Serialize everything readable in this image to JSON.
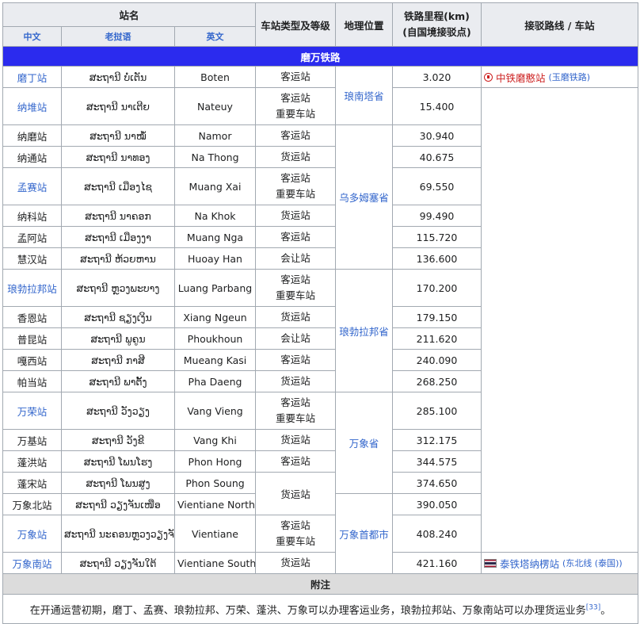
{
  "header": {
    "station_name": "站名",
    "zh": "中文",
    "lao": "老挝语",
    "en": "英文",
    "type": "车站类型及等级",
    "location": "地理位置",
    "mileage_line1": "铁路里程(km)",
    "mileage_line2": "(自国境接驳点)",
    "connection": "接驳路线 / 车站"
  },
  "banner": "磨万铁路",
  "stations": [
    {
      "zh": "磨丁站",
      "link": true,
      "lao": "ສະຖານີ ບໍ່ເຕັນ",
      "en": "Boten",
      "type": [
        "客运站"
      ],
      "km": "3.020"
    },
    {
      "zh": "纳堆站",
      "link": true,
      "lao": "ສະຖານີ ນາເຕີຍ",
      "en": "Nateuy",
      "type": [
        "客运站",
        "重要车站"
      ],
      "km": "15.400"
    },
    {
      "zh": "纳磨站",
      "link": false,
      "lao": "ສະຖານີ ນາໝໍ້",
      "en": "Namor",
      "type": [
        "客运站"
      ],
      "km": "30.940"
    },
    {
      "zh": "纳通站",
      "link": false,
      "lao": "ສະຖານີ ນາທອງ",
      "en": "Na Thong",
      "type": [
        "货运站"
      ],
      "km": "40.675"
    },
    {
      "zh": "孟赛站",
      "link": true,
      "lao": "ສະຖານີ ເມືອງໄຊ",
      "en": "Muang Xai",
      "type": [
        "客运站",
        "重要车站"
      ],
      "km": "69.550"
    },
    {
      "zh": "纳科站",
      "link": false,
      "lao": "ສະຖານີ ນາຄອກ",
      "en": "Na Khok",
      "type": [
        "货运站"
      ],
      "km": "99.490"
    },
    {
      "zh": "孟阿站",
      "link": false,
      "lao": "ສະຖານີ ເມືອງງາ",
      "en": "Muang Nga",
      "type": [
        "客运站"
      ],
      "km": "115.720"
    },
    {
      "zh": "慧汉站",
      "link": false,
      "lao": "ສະຖານີ ຫ້ວຍຫານ",
      "en": "Huoay Han",
      "type": [
        "会让站"
      ],
      "km": "136.600"
    },
    {
      "zh": "琅勃拉邦站",
      "link": true,
      "lao": "ສະຖານີ ຫຼວງພະບາງ",
      "en": "Luang Parbang",
      "type": [
        "客运站",
        "重要车站"
      ],
      "km": "170.200"
    },
    {
      "zh": "香恩站",
      "link": false,
      "lao": "ສະຖານີ ຊຽງເງິນ",
      "en": "Xiang Ngeun",
      "type": [
        "货运站"
      ],
      "km": "179.150"
    },
    {
      "zh": "普昆站",
      "link": false,
      "lao": "ສະຖານີ ພູຄູນ",
      "en": "Phoukhoun",
      "type": [
        "会让站"
      ],
      "km": "211.620"
    },
    {
      "zh": "嘎西站",
      "link": false,
      "lao": "ສະຖານີ ກາສີ",
      "en": "Mueang Kasi",
      "type": [
        "客运站"
      ],
      "km": "240.090"
    },
    {
      "zh": "帕当站",
      "link": false,
      "lao": "ສະຖານີ ພາຕັ້ງ",
      "en": "Pha Daeng",
      "type": [
        "货运站"
      ],
      "km": "268.250"
    },
    {
      "zh": "万荣站",
      "link": true,
      "lao": "ສະຖານີ ວັງວຽງ",
      "en": "Vang Vieng",
      "type": [
        "客运站",
        "重要车站"
      ],
      "km": "285.100"
    },
    {
      "zh": "万基站",
      "link": false,
      "lao": "ສະຖານີ ວັງຂີ",
      "en": "Vang Khi",
      "type": [
        "货运站"
      ],
      "km": "312.175"
    },
    {
      "zh": "蓬洪站",
      "link": false,
      "lao": "ສະຖານີ ໂພນໂຮງ",
      "en": "Phon Hong",
      "type": [
        "客运站"
      ],
      "km": "344.575"
    },
    {
      "zh": "蓬宋站",
      "link": false,
      "lao": "ສະຖານີ ໂພນສູງ",
      "en": "Phon Soung",
      "type": [
        "货运站"
      ],
      "km": "374.650"
    },
    {
      "zh": "万象北站",
      "link": false,
      "lao": "ສະຖານີ ວຽງຈັນເໜືອ",
      "en": "Vientiane North",
      "type": [],
      "km": "390.050"
    },
    {
      "zh": "万象站",
      "link": true,
      "lao": "ສະຖານີ ນະຄອນຫຼວງວຽງຈັນ",
      "en": "Vientiane",
      "type": [
        "客运站",
        "重要车站"
      ],
      "km": "408.240"
    },
    {
      "zh": "万象南站",
      "link": true,
      "lao": "ສະຖານີ ວຽງຈັນໃຕ້",
      "en": "Vientiane South",
      "type": [
        "货运站"
      ],
      "km": "421.160"
    }
  ],
  "merged_type_fr": "货运站",
  "provinces": {
    "p1": "琅南塔省",
    "p2": "乌多姆塞省",
    "p3": "琅勃拉邦省",
    "p4": "万象省",
    "p5": "万象首都市"
  },
  "connections": {
    "boten": {
      "station": "中铁磨憨站",
      "line": "(玉磨铁路)",
      "icon": "china-railway-icon",
      "color": "#cc1f1f"
    },
    "vientiane_south": {
      "station": "泰铁塔纳楞站",
      "line": "(东北线 (泰国))",
      "icon": "thailand-flag-icon"
    }
  },
  "note_title": "附注",
  "note_text": "在开通运营初期，磨丁、孟赛、琅勃拉邦、万荣、蓬洪、万象可以办理客运业务，琅勃拉邦站、万象南站可以办理货运业务",
  "note_ref": "[33]",
  "note_end": "。",
  "colors": {
    "banner": "#2b2bee",
    "link": "#3366cc",
    "header_bg": "#eaecf0"
  }
}
